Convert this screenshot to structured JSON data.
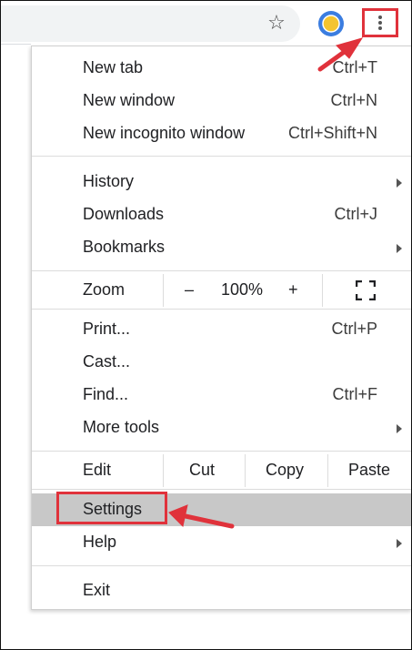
{
  "toolbar": {
    "bookmark_icon": "star-icon",
    "extension_icon": "extension-icon",
    "menu_icon": "vertical-dots-icon"
  },
  "menu": {
    "new_tab": {
      "label": "New tab",
      "shortcut": "Ctrl+T"
    },
    "new_window": {
      "label": "New window",
      "shortcut": "Ctrl+N"
    },
    "new_incognito": {
      "label": "New incognito window",
      "shortcut": "Ctrl+Shift+N"
    },
    "history": {
      "label": "History"
    },
    "downloads": {
      "label": "Downloads",
      "shortcut": "Ctrl+J"
    },
    "bookmarks": {
      "label": "Bookmarks"
    },
    "zoom": {
      "label": "Zoom",
      "minus": "–",
      "level": "100%",
      "plus": "+"
    },
    "print": {
      "label": "Print...",
      "shortcut": "Ctrl+P"
    },
    "cast": {
      "label": "Cast..."
    },
    "find": {
      "label": "Find...",
      "shortcut": "Ctrl+F"
    },
    "more_tools": {
      "label": "More tools"
    },
    "edit": {
      "label": "Edit",
      "cut": "Cut",
      "copy": "Copy",
      "paste": "Paste"
    },
    "settings": {
      "label": "Settings"
    },
    "help": {
      "label": "Help"
    },
    "exit": {
      "label": "Exit"
    }
  },
  "colors": {
    "annotation_red": "#e0323b",
    "highlight_gray": "#c8c8c8",
    "extension_blue": "#3b7de0",
    "extension_yellow": "#f4c430"
  }
}
